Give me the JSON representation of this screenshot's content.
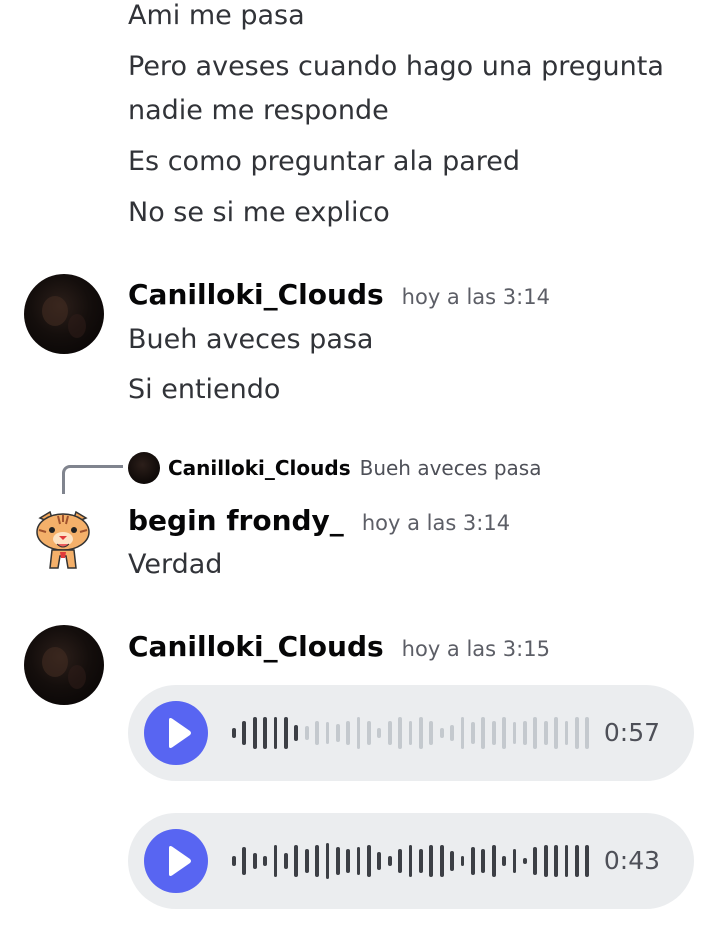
{
  "messages_top": [
    "Ami me pasa",
    "Pero aveses cuando hago una pregunta",
    "nadie me responde",
    "Es como preguntar ala pared",
    "No se si me explico"
  ],
  "group1": {
    "username": "Canilloki_Clouds",
    "timestamp": "hoy a las 3:14",
    "lines": [
      "Bueh aveces pasa",
      "Si entiendo"
    ]
  },
  "reply": {
    "username": "Canilloki_Clouds",
    "text": "Bueh aveces pasa"
  },
  "group2": {
    "username": "begin frondy_",
    "timestamp": "hoy a las 3:14",
    "lines": [
      "Verdad"
    ]
  },
  "group3": {
    "username": "Canilloki_Clouds",
    "timestamp": "hoy a las 3:15",
    "voice_messages": [
      {
        "duration": "0:57",
        "played_fraction": 0.2,
        "waveform": [
          0.25,
          0.6,
          0.8,
          0.8,
          0.8,
          0.8,
          0.4,
          0.35,
          0.6,
          0.55,
          0.45,
          0.6,
          0.8,
          0.6,
          0.25,
          0.6,
          0.8,
          0.6,
          0.8,
          0.6,
          0.25,
          0.4,
          0.8,
          0.55,
          0.8,
          0.6,
          0.8,
          0.55,
          0.6,
          0.8,
          0.6,
          0.8,
          0.6,
          0.8,
          0.8
        ],
        "color_played": "#3c3f45",
        "color_unplayed": "#c4c9ce"
      },
      {
        "duration": "0:43",
        "played_fraction": 1.0,
        "waveform": [
          0.25,
          0.7,
          0.4,
          0.25,
          0.8,
          0.4,
          0.8,
          0.6,
          0.8,
          0.9,
          0.7,
          0.6,
          0.7,
          0.8,
          0.45,
          0.25,
          0.6,
          0.8,
          0.6,
          0.8,
          0.8,
          0.5,
          0.25,
          0.7,
          0.6,
          0.8,
          0.25,
          0.6,
          0.15,
          0.7,
          0.8,
          0.8,
          0.8,
          0.8,
          0.8
        ],
        "color_played": "#3c3f45",
        "color_unplayed": "#c4c9ce"
      }
    ]
  },
  "colors": {
    "play_button": "#5865f2",
    "voice_bg": "#ebedef",
    "text": "#313338",
    "username": "#060607",
    "timestamp": "#5c5e66"
  },
  "icons": {
    "play": "play-icon",
    "avatar_tiger": "tiger-avatar-icon"
  }
}
